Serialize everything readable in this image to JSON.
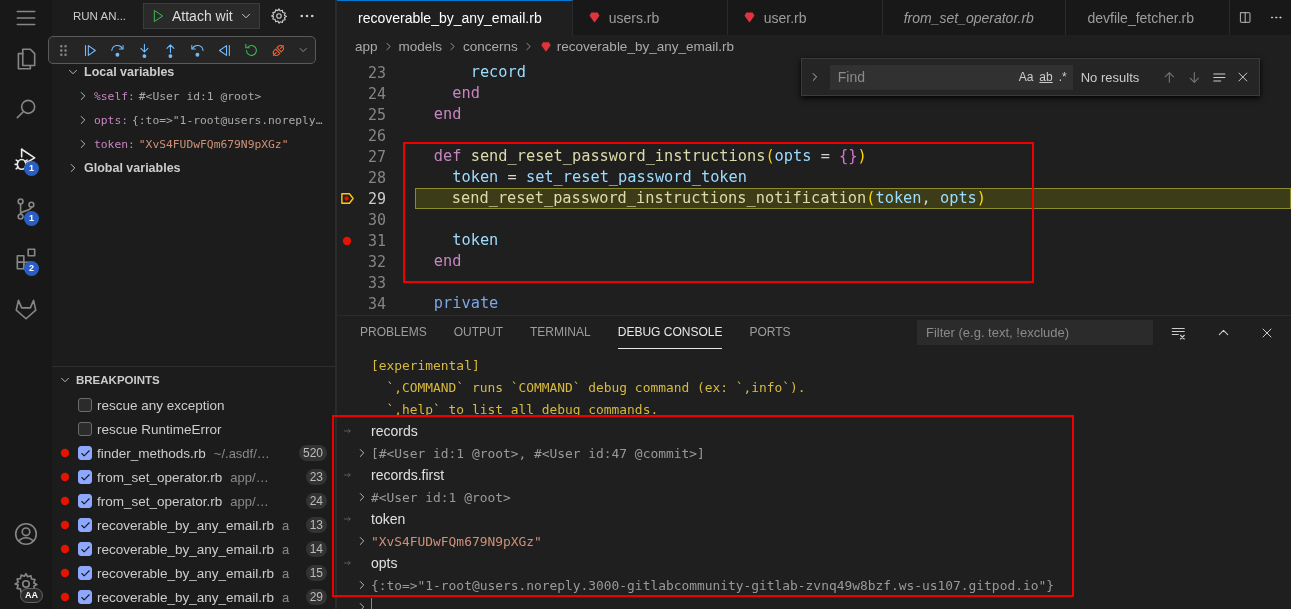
{
  "activity_bar": {
    "items": [
      {
        "kind": "menu",
        "selected": false
      },
      {
        "kind": "explorer",
        "selected": false
      },
      {
        "kind": "search",
        "selected": false
      },
      {
        "kind": "run-debug",
        "selected": true,
        "badge": "1"
      },
      {
        "kind": "source-control",
        "selected": false,
        "badge": "1"
      },
      {
        "kind": "extensions",
        "selected": false,
        "badge": "2"
      },
      {
        "kind": "fox",
        "selected": false
      }
    ],
    "bottom": [
      {
        "kind": "account"
      },
      {
        "kind": "manage",
        "badge": "AA"
      }
    ]
  },
  "sidebar": {
    "title": "RUN AN...",
    "config": "Attach wit",
    "variables": [
      {
        "label": "Local variables",
        "expanded": true,
        "children": [
          {
            "name": "%self:",
            "value": "#<User id:1 @root>",
            "kind": "object",
            "expanded": false
          },
          {
            "name": "opts:",
            "value": "{:to=>\"1-root@users.noreply…",
            "kind": "object",
            "expanded": false
          },
          {
            "name": "token:",
            "value": "\"XvS4FUDwFQm679N9pXGz\"",
            "kind": "string",
            "expanded": false
          }
        ]
      },
      {
        "label": "Global variables",
        "expanded": false
      }
    ],
    "breakpoints": {
      "title": "BREAKPOINTS",
      "expanded": true,
      "items": [
        {
          "kind": "exception",
          "label": "rescue any exception",
          "checked": false
        },
        {
          "kind": "exception",
          "label": "rescue RuntimeError",
          "checked": false
        },
        {
          "kind": "file",
          "label": "finder_methods.rb",
          "path": "~/.asdf/…",
          "line": "520",
          "checked": true
        },
        {
          "kind": "file",
          "label": "from_set_operator.rb",
          "path": "app/…",
          "line": "23",
          "checked": true
        },
        {
          "kind": "file",
          "label": "from_set_operator.rb",
          "path": "app/…",
          "line": "24",
          "checked": true
        },
        {
          "kind": "file",
          "label": "recoverable_by_any_email.rb",
          "path": "a",
          "line": "13",
          "checked": true
        },
        {
          "kind": "file",
          "label": "recoverable_by_any_email.rb",
          "path": "a",
          "line": "14",
          "checked": true
        },
        {
          "kind": "file",
          "label": "recoverable_by_any_email.rb",
          "path": "a",
          "line": "15",
          "checked": true
        },
        {
          "kind": "file",
          "label": "recoverable_by_any_email.rb",
          "path": "a",
          "line": "29",
          "checked": true
        }
      ]
    }
  },
  "editor": {
    "tabs": [
      {
        "label": "recoverable_by_any_email.rb",
        "selected": true,
        "preview": false
      },
      {
        "label": "users.rb",
        "selected": false,
        "preview": false
      },
      {
        "label": "user.rb",
        "selected": false,
        "preview": false
      },
      {
        "label": "from_set_operator.rb",
        "selected": false,
        "preview": true
      },
      {
        "label": "devfile_fetcher.rb",
        "selected": false,
        "preview": false
      }
    ],
    "breadcrumb": [
      "app",
      "models",
      "concerns",
      "recoverable_by_any_email.rb"
    ],
    "find": {
      "placeholder": "Find",
      "options": [
        "Aa",
        "ab",
        ".*"
      ],
      "status": "No results"
    },
    "lines": [
      {
        "number": "23",
        "current": false,
        "breakpoint": false,
        "kind": "nested",
        "tokens": [
          {
            "kind": "var",
            "text": "record"
          }
        ]
      },
      {
        "number": "24",
        "current": false,
        "breakpoint": false,
        "kind": "body",
        "tokens": [
          {
            "kind": "keyword",
            "text": "end"
          }
        ]
      },
      {
        "number": "25",
        "current": false,
        "breakpoint": false,
        "kind": "method",
        "tokens": [
          {
            "kind": "keyword",
            "text": "end"
          }
        ]
      },
      {
        "number": "26",
        "current": false,
        "breakpoint": false
      },
      {
        "number": "27",
        "current": false,
        "breakpoint": false,
        "kind": "method",
        "tokens": [
          {
            "kind": "keyword",
            "text": "def"
          },
          {
            "kind": "function",
            "text": "send_reset_password_instructions"
          },
          {
            "kind": "paren",
            "text": "("
          },
          {
            "kind": "var",
            "text": "opts"
          },
          {
            "kind": "plain",
            "text": " = "
          },
          {
            "kind": "brace",
            "text": "{}"
          },
          {
            "kind": "paren",
            "text": ")"
          }
        ]
      },
      {
        "number": "28",
        "current": false,
        "breakpoint": false,
        "kind": "body",
        "tokens": [
          {
            "kind": "var",
            "text": "token"
          },
          {
            "kind": "plain",
            "text": " = "
          },
          {
            "kind": "var",
            "text": "set_reset_password_token"
          }
        ]
      },
      {
        "number": "29",
        "current": true,
        "breakpoint": true,
        "kind": "body",
        "tokens": [
          {
            "kind": "function",
            "text": "send_reset_password_instructions_notification"
          },
          {
            "kind": "paren",
            "text": "("
          },
          {
            "kind": "var",
            "text": "token"
          },
          {
            "kind": "plain",
            "text": ", "
          },
          {
            "kind": "var",
            "text": "opts"
          },
          {
            "kind": "paren",
            "text": ")"
          }
        ]
      },
      {
        "number": "30",
        "current": false,
        "breakpoint": false
      },
      {
        "number": "31",
        "current": false,
        "breakpoint": true,
        "kind": "body",
        "tokens": [
          {
            "kind": "var",
            "text": "token"
          }
        ]
      },
      {
        "number": "32",
        "current": false,
        "breakpoint": false,
        "kind": "method",
        "tokens": [
          {
            "kind": "keyword",
            "text": "end"
          }
        ]
      },
      {
        "number": "33",
        "current": false,
        "breakpoint": false
      },
      {
        "number": "34",
        "current": false,
        "breakpoint": false,
        "kind": "method",
        "tokens": [
          {
            "kind": "modifier",
            "text": "private"
          }
        ]
      }
    ]
  },
  "panel": {
    "tabs": [
      {
        "label": "PROBLEMS",
        "selected": false
      },
      {
        "label": "OUTPUT",
        "selected": false
      },
      {
        "label": "TERMINAL",
        "selected": false
      },
      {
        "label": "DEBUG CONSOLE",
        "selected": true
      },
      {
        "label": "PORTS",
        "selected": false
      }
    ],
    "filter_placeholder": "Filter (e.g. text, !exclude)",
    "console": [
      {
        "kind": "info",
        "text": "[experimental]"
      },
      {
        "kind": "info",
        "text": "  `,COMMAND` runs `COMMAND` debug command (ex: `,info`)."
      },
      {
        "kind": "info",
        "text": "  `,help` to list all debug commands."
      },
      {
        "kind": "input",
        "text": "records"
      },
      {
        "kind": "output",
        "text": "[#<User id:1 @root>, #<User id:47 @commit>]"
      },
      {
        "kind": "input",
        "text": "records.first"
      },
      {
        "kind": "output",
        "text": "#<User id:1 @root>"
      },
      {
        "kind": "input",
        "text": "token"
      },
      {
        "kind": "output-string",
        "text": "\"XvS4FUDwFQm679N9pXGz\""
      },
      {
        "kind": "input",
        "text": "opts"
      },
      {
        "kind": "output",
        "text": "{:to=>\"1-root@users.noreply.3000-gitlabcommunity-gitlab-zvnq49w8bzf.ws-us107.gitpod.io\"}"
      }
    ]
  }
}
